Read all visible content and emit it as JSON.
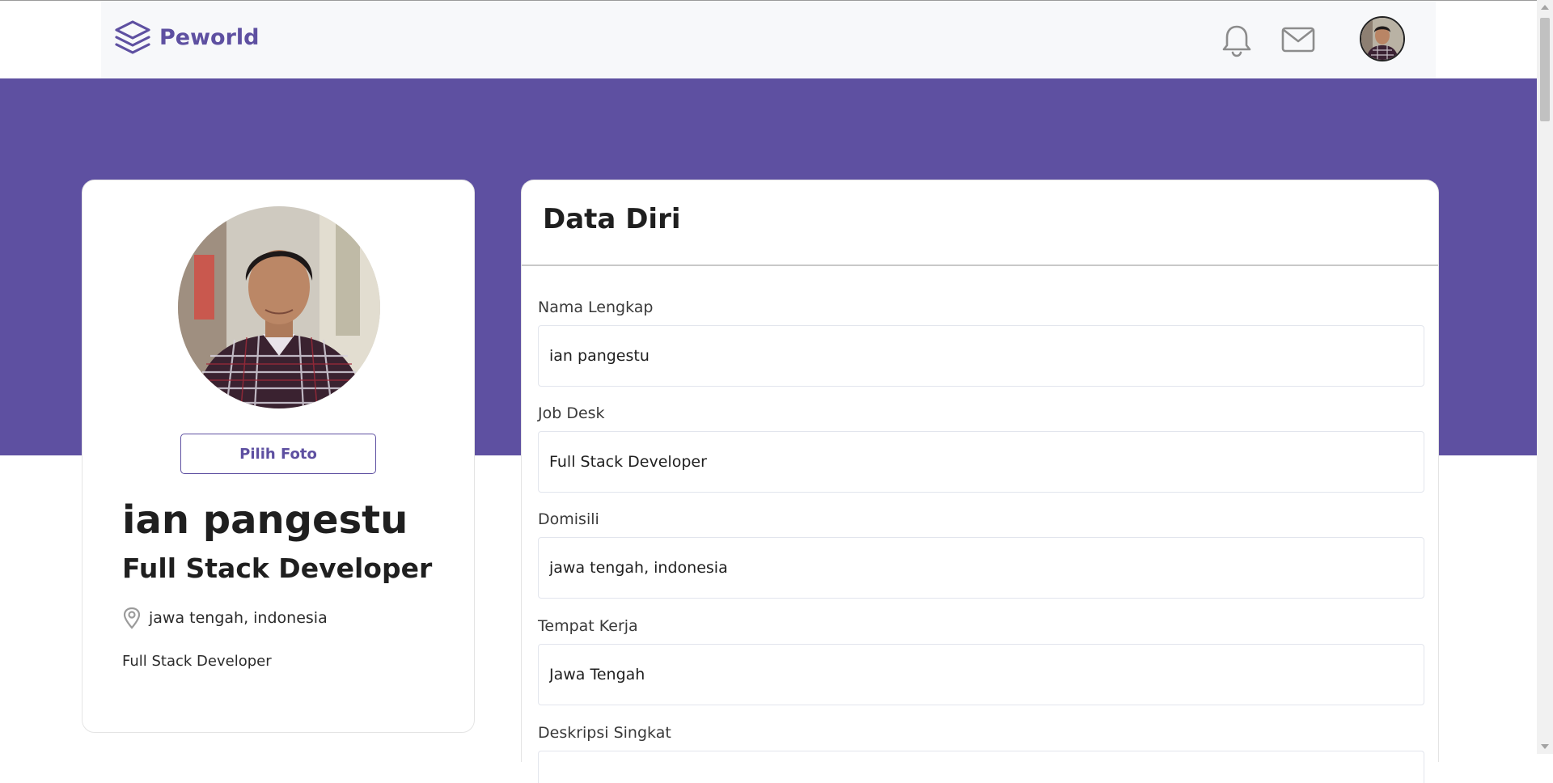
{
  "navbar": {
    "brand": "Peworld",
    "icons": [
      "layers-logo-icon",
      "bell-icon",
      "mail-icon",
      "user-avatar"
    ]
  },
  "colors": {
    "brand": "#5e50a1",
    "banner": "#5e50a1",
    "navbar_bg": "#f7f8fa"
  },
  "profile": {
    "pick_photo_label": "Pilih Foto",
    "name": "ian pangestu",
    "job": "Full Stack Developer",
    "location": "jawa tengah, indonesia",
    "description": "Full Stack Developer"
  },
  "form": {
    "title": "Data Diri",
    "fields": [
      {
        "label": "Nama Lengkap",
        "value": "ian pangestu"
      },
      {
        "label": "Job Desk",
        "value": "Full Stack Developer"
      },
      {
        "label": "Domisili",
        "value": "jawa tengah, indonesia"
      },
      {
        "label": "Tempat Kerja",
        "value": "Jawa Tengah"
      },
      {
        "label": "Deskripsi Singkat",
        "value": ""
      }
    ]
  }
}
